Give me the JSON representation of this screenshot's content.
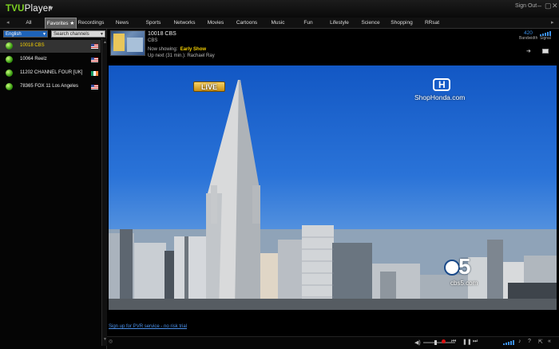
{
  "app": {
    "logo_tvu": "TVU",
    "logo_player": "Player",
    "signout": "Sign Out"
  },
  "tabs": [
    {
      "label": "All"
    },
    {
      "label": "Favorites"
    },
    {
      "label": "Recordings"
    },
    {
      "label": "News"
    },
    {
      "label": "Sports"
    },
    {
      "label": "Networks"
    },
    {
      "label": "Movies"
    },
    {
      "label": "Cartoons"
    },
    {
      "label": "Music"
    },
    {
      "label": "Fun"
    },
    {
      "label": "Lifestyle"
    },
    {
      "label": "Science"
    },
    {
      "label": "Shopping"
    },
    {
      "label": "RRsat"
    }
  ],
  "sidebar": {
    "language": "English",
    "search_placeholder": "Search channels",
    "channels": [
      {
        "name": "10018 CBS",
        "flag": "us",
        "selected": true
      },
      {
        "name": "10064 Reelz",
        "flag": "us",
        "selected": false
      },
      {
        "name": "11202 CHANNEL FOUR [UK]",
        "flag": "ie",
        "selected": false
      },
      {
        "name": "78365 FOX 11 Los Angeles",
        "flag": "us",
        "selected": false
      }
    ]
  },
  "nowplaying": {
    "title": "10018 CBS",
    "network": "CBS",
    "now_label": "Now showing:",
    "now_show": "Early Show",
    "next": "Up next (31 min.):  Rachael Ray",
    "bandwidth_value": "420",
    "bandwidth_label": "Bandwidth",
    "signal_label": "Signal"
  },
  "video": {
    "live_badge": "LIVE",
    "sponsor_text": "ShopHonda.com",
    "station_text": "cbs5.com"
  },
  "footer": {
    "pvr_link": "Sign up for PVR service - no risk trial"
  },
  "colors": {
    "accent_blue": "#3b8fe6",
    "selected_channel": "#f5d000",
    "logo_green": "#7ed321"
  }
}
